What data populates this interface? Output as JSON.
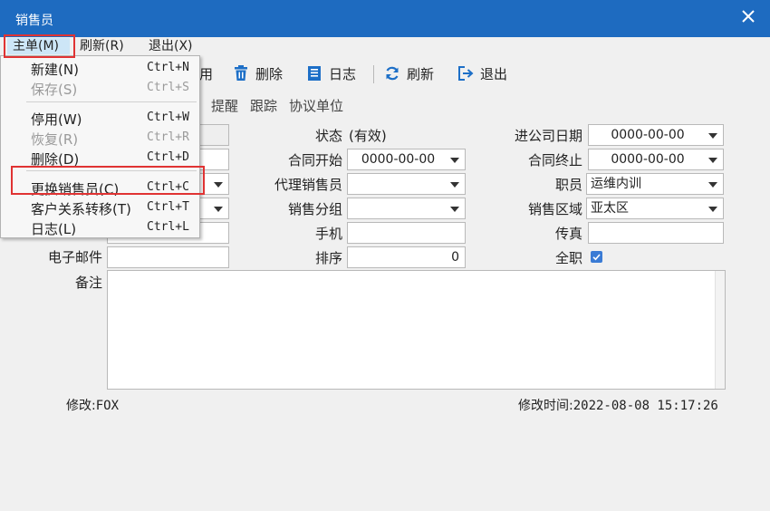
{
  "window": {
    "title": "销售员"
  },
  "menubar": {
    "main": "主单(M)",
    "refresh": "刷新(R)",
    "exit": "退出(X)"
  },
  "toolbar": {
    "disable_partial": "用",
    "delete": "删除",
    "log": "日志",
    "refresh": "刷新",
    "exit": "退出"
  },
  "tabs": [
    "提醒",
    "跟踪",
    "协议单位"
  ],
  "form": {
    "status_label": "状态",
    "status_value": "(有效)",
    "join_date_label": "进公司日期",
    "join_date_value": "0000-00-00",
    "contract_start_label": "合同开始",
    "contract_start_value": "0000-00-00",
    "contract_end_label": "合同终止",
    "contract_end_value": "0000-00-00",
    "agent_label": "代理销售员",
    "agent_value": "",
    "position_label": "职员",
    "position_value": "运维内训",
    "sales_group_label": "销售分组",
    "sales_group_value": "",
    "sales_region_label": "销售区域",
    "sales_region_value": "亚太区",
    "mobile_label": "手机",
    "mobile_value": "",
    "fax_label": "传真",
    "fax_value": "",
    "email_label": "电子邮件",
    "email_value": "",
    "sort_label": "排序",
    "sort_value": "0",
    "fulltime_label": "全职",
    "fulltime_checked": true,
    "remarks_label": "备注",
    "remarks_value": ""
  },
  "footer": {
    "modifier_label": "修改:",
    "modifier_value": "FOX",
    "modified_time_label": "修改时间:",
    "modified_time_value": "2022-08-08 15:17:26"
  },
  "dropdown_menu": {
    "items": [
      {
        "label": "新建(N)",
        "shortcut": "Ctrl+N",
        "enabled": true
      },
      {
        "label": "保存(S)",
        "shortcut": "Ctrl+S",
        "enabled": false
      },
      {
        "label": "停用(W)",
        "shortcut": "Ctrl+W",
        "enabled": true
      },
      {
        "label": "恢复(R)",
        "shortcut": "Ctrl+R",
        "enabled": false
      },
      {
        "label": "删除(D)",
        "shortcut": "Ctrl+D",
        "enabled": true
      },
      {
        "label": "更换销售员(C)",
        "shortcut": "Ctrl+C",
        "enabled": true
      },
      {
        "label": "客户关系转移(T)",
        "shortcut": "Ctrl+T",
        "enabled": true
      },
      {
        "label": "日志(L)",
        "shortcut": "Ctrl+L",
        "enabled": true
      }
    ]
  },
  "colors": {
    "titlebar": "#1e6bc0",
    "highlight_box": "#e03333",
    "toolbar_icon": "#1d6fc7",
    "checkbox": "#3a7bd5"
  }
}
